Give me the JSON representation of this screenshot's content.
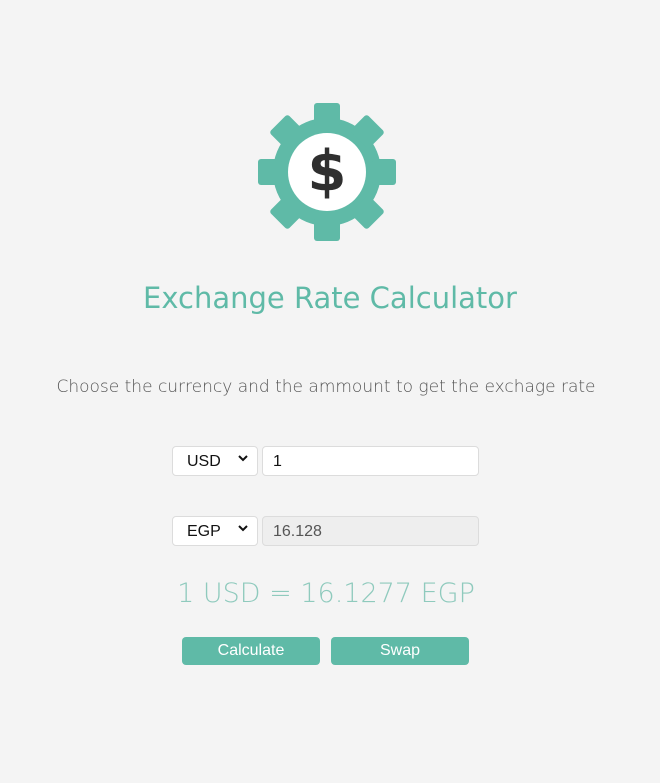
{
  "logo": {
    "icon": "dollar-gear-icon",
    "color": "#5fbaa7"
  },
  "title": "Exchange Rate Calculator",
  "subtitle": "Choose the currency and the ammount to get the exchage rate",
  "from": {
    "currency": "USD",
    "amount": "1"
  },
  "to": {
    "currency": "EGP",
    "amount": "16.128"
  },
  "rate_text": "1 USD = 16.1277 EGP",
  "buttons": {
    "calculate": "Calculate",
    "swap": "Swap"
  },
  "colors": {
    "accent": "#5fbaa7",
    "background": "#f4f4f4"
  }
}
